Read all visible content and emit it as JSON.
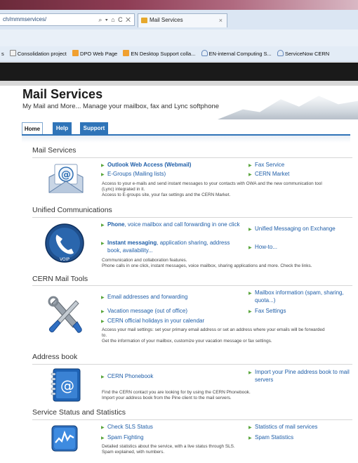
{
  "browser": {
    "address": "ch/mmmservices/",
    "address_controls": "⌕ ▾ ⌂ C ✕",
    "tab_title": "Mail Services",
    "tab_close": "×",
    "favorites": [
      {
        "label": "s",
        "icon": "none"
      },
      {
        "label": "Consolidation project",
        "icon": "page"
      },
      {
        "label": "DPO Web Page",
        "icon": "orange"
      },
      {
        "label": "EN Desktop Support colla...",
        "icon": "orange"
      },
      {
        "label": "EN-internal Computing S...",
        "icon": "cloud"
      },
      {
        "label": "ServiceNow CERN",
        "icon": "cloud"
      }
    ]
  },
  "header": {
    "title": "Mail Services",
    "subtitle": "My Mail and More... Manage your mailbox, fax and Lync softphone"
  },
  "nav": {
    "tabs": [
      "Home",
      "Help",
      "Support"
    ],
    "active": "Home"
  },
  "sections": {
    "mail": {
      "title": "Mail Services",
      "icon": "email-at-icon",
      "links": {
        "owa": "Outlook Web Access (Webmail)",
        "egroups": "E-Groups (Mailing lists)",
        "fax": "Fax Service",
        "market": "CERN Market"
      },
      "desc": [
        "Access to your e-mails and send instant messages to your contacts with OWA and the new communication tool",
        "(Lync) integrated in it.",
        "Access to E-groups site, your fax settings and the CERN Market."
      ]
    },
    "uc": {
      "title": "Unified Communications",
      "icon": "voip-phone-icon",
      "icon_label": "VOIP",
      "links": {
        "phone_bold": "Phone",
        "phone_rest": ", voice mailbox and call forwarding in one click",
        "im_bold": "Instant messaging",
        "im_rest": ", application sharing, address book, availability...",
        "um": "Unified Messaging on Exchange",
        "howto": "How-to..."
      },
      "desc": [
        "Communication and collaboration features.",
        "Phone calls in one click, instant messages, voice mailbox, sharing applications and more. Check the links."
      ]
    },
    "tools": {
      "title": "CERN Mail Tools",
      "icon": "tools-icon",
      "links": {
        "addresses": "Email addresses and forwarding",
        "vacation": "Vacation message (out of office)",
        "holidays": "CERN official holidays in your calendar",
        "mailbox_info": "Mailbox information (spam, sharing, quota...)",
        "fax_settings": "Fax Settings"
      },
      "desc": [
        "Access your mail settings: set your primary email address or set an address where your emails will be forwarded",
        "to.",
        "Get the information of your mailbox, customize your vacation message or fax settings."
      ]
    },
    "address": {
      "title": "Address book",
      "icon": "address-book-icon",
      "links": {
        "phonebook": "CERN Phonebook",
        "pine": "Import your Pine address book to mail servers"
      },
      "desc": [
        "Find the CERN contact you are looking for by using the CERN Phonebook.",
        "Import your address book from the Pine client to the mail servers."
      ]
    },
    "status": {
      "title": "Service Status and Statistics",
      "icon": "statistics-chart-icon",
      "links": {
        "sls": "Check SLS Status",
        "spam_fighting": "Spam Fighting",
        "mail_stats": "Statistics of mail services",
        "spam_stats": "Spam Statistics"
      },
      "desc": [
        "Detailed statistics about the service, with a live status through SLS.",
        "Spam explained, with numbers."
      ]
    }
  }
}
